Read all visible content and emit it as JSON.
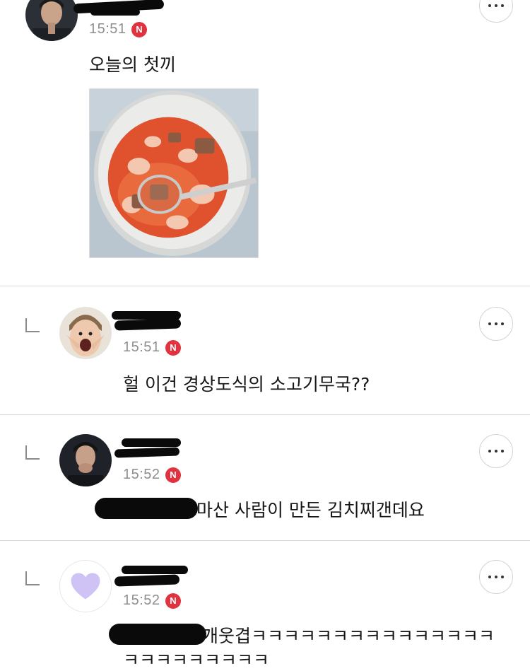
{
  "post": {
    "time": "15:51",
    "badge": "N",
    "text": "오늘의 첫끼",
    "image_alt": "kimchi stew with rice in bowl"
  },
  "replies": [
    {
      "time": "15:51",
      "badge": "N",
      "text": "헐 이건 경상도식의 소고기무국??"
    },
    {
      "time": "15:52",
      "badge": "N",
      "text": "마산 사람이 만든 김치찌갠데요"
    },
    {
      "time": "15:52",
      "badge": "N",
      "text_line1": "개웃겹ㅋㅋㅋㅋㅋㅋㅋㅋㅋㅋㅋㅋㅋㅋㅋ",
      "text_line2": "ㅋㅋㅋㅋㅋㅋㅋㅋㅋ"
    }
  ],
  "icons": {
    "more": "more-options-icon",
    "reply": "reply-indent-icon",
    "heart": "heart-icon"
  },
  "colors": {
    "badge": "#e0323f",
    "heart": "#cfc3f5",
    "time": "#8e8e8e"
  }
}
